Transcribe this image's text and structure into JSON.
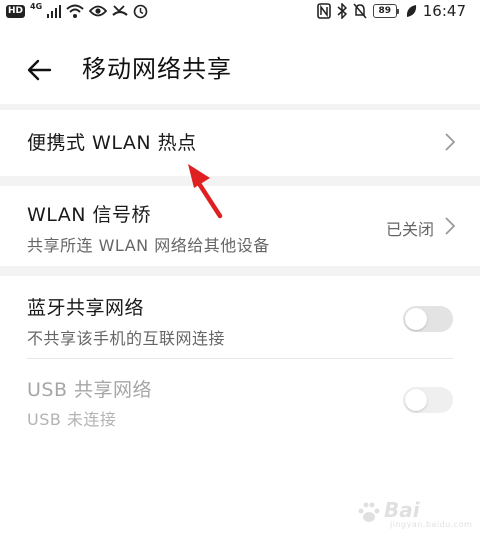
{
  "status_bar": {
    "hd": "HD",
    "net": "4G",
    "battery": "89",
    "time": "16:47"
  },
  "header": {
    "title": "移动网络共享"
  },
  "items": {
    "hotspot": {
      "title": "便携式 WLAN 热点"
    },
    "bridge": {
      "title": "WLAN 信号桥",
      "subtitle": "共享所连 WLAN 网络给其他设备",
      "status": "已关闭"
    },
    "bluetooth": {
      "title": "蓝牙共享网络",
      "subtitle": "不共享该手机的互联网连接",
      "toggle_on": false
    },
    "usb": {
      "title": "USB 共享网络",
      "subtitle": "USB 未连接",
      "toggle_on": false,
      "enabled": false
    }
  },
  "annotation": {
    "arrow_color": "#e02020"
  },
  "watermark": {
    "brand": "Bai",
    "sub": "jingyan.baidu.com"
  }
}
